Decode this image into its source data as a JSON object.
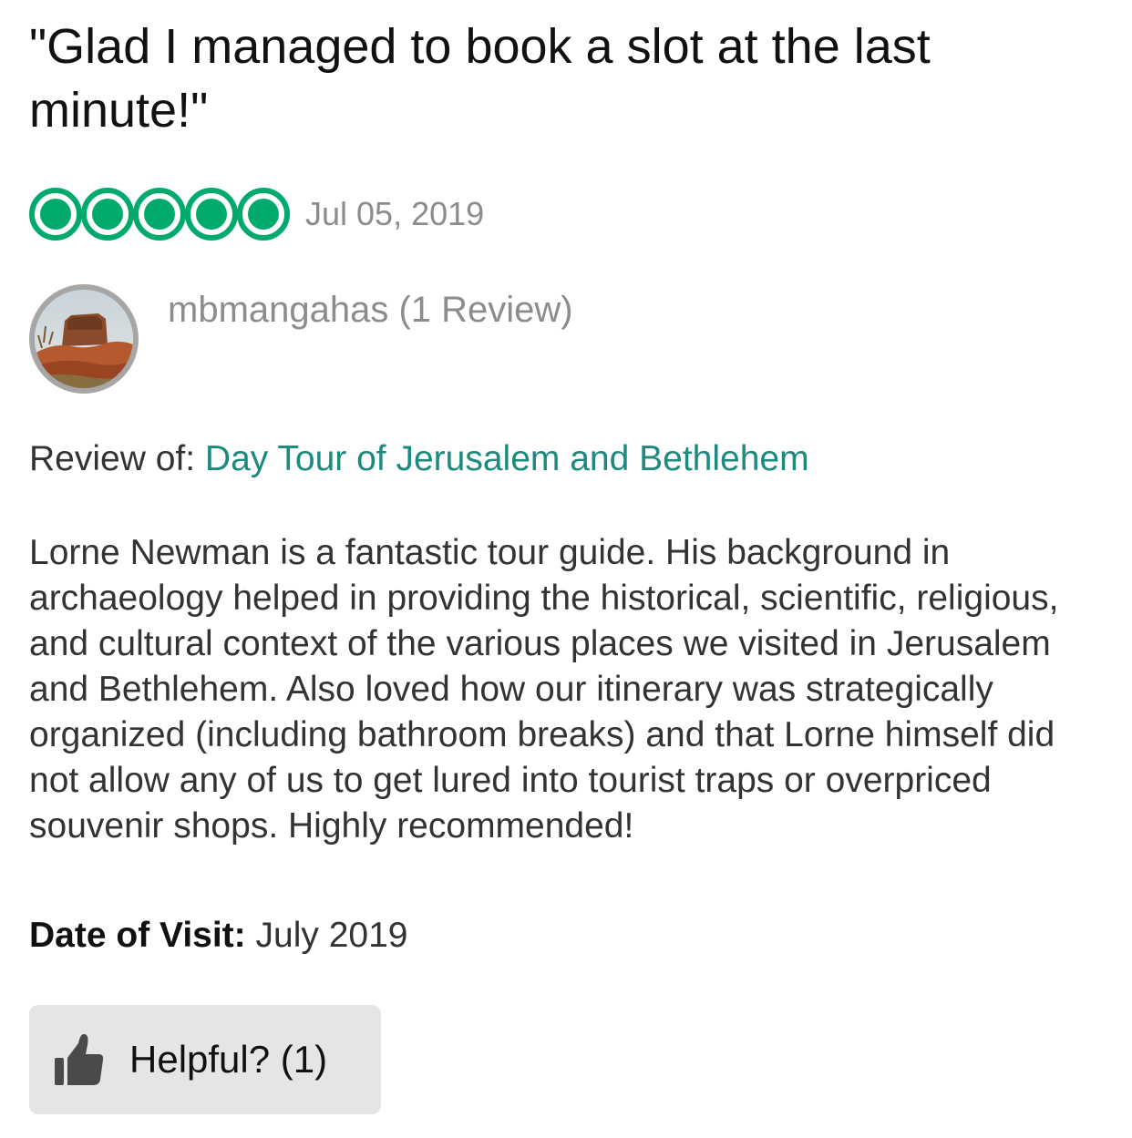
{
  "review": {
    "title": "\"Glad I managed to book a slot at the last minute!\"",
    "rating": 5,
    "rating_max": 5,
    "rating_icon": "rating-bubble-icon",
    "accent_color": "#00aa6c",
    "date": "Jul 05, 2019",
    "reviewer": {
      "name_line": "mbmangahas (1 Review)",
      "avatar_icon": "avatar-photo"
    },
    "review_of": {
      "label": "Review of:",
      "link_text": "Day Tour of Jerusalem and Bethlehem",
      "link_color": "#1d8a7e"
    },
    "body": "Lorne Newman is a fantastic tour guide. His background in archaeology helped in providing the historical, scientific, religious, and cultural context of the various places we visited in Jerusalem and Bethlehem. Also loved how our itinerary was strategically organized (including bathroom breaks) and that Lorne himself did not allow any of us to get lured into tourist traps or overpriced souvenir shops. Highly recommended!",
    "date_of_visit": {
      "label": "Date of Visit:",
      "value": "July 2019"
    },
    "helpful": {
      "label": "Helpful? (1)",
      "icon": "thumbs-up-icon"
    }
  }
}
